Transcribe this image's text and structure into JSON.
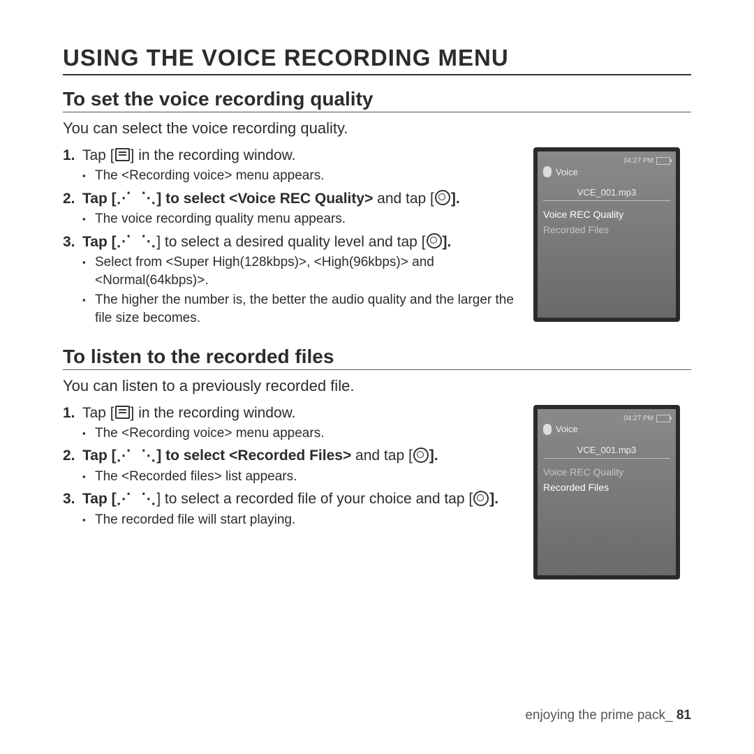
{
  "page": {
    "h1": "USING THE VOICE RECORDING MENU",
    "footer_text": "enjoying the prime pack_",
    "footer_page": "81"
  },
  "sec1": {
    "h2": "To set the voice recording quality",
    "intro": "You can select the voice recording quality.",
    "s1_pre": "Tap [",
    "s1_post": "] in the recording window.",
    "s1_sub1": "The <Recording voice> menu appears.",
    "s2_pre": "Tap [",
    "s2_mid1": "] to select ",
    "s2_bold": "<Voice REC Quality>",
    "s2_mid2": " and tap [",
    "s2_post": "].",
    "s2_sub1": "The voice recording quality menu appears.",
    "s3_pre": "Tap [",
    "s3_mid": "] to select a desired quality level and tap [",
    "s3_post": "].",
    "s3_sub1": "Select from <Super High(128kbps)>, <High(96kbps)> and <Normal(64kbps)>.",
    "s3_sub2": "The higher the number is, the better the audio quality and the larger the file size becomes."
  },
  "sec2": {
    "h2": "To listen to the recorded files",
    "intro": "You can listen to a previously recorded file.",
    "s1_pre": "Tap [",
    "s1_post": "] in the recording window.",
    "s1_sub1": "The <Recording voice> menu appears.",
    "s2_pre": "Tap [",
    "s2_mid1": "] to select ",
    "s2_bold": "<Recorded Files>",
    "s2_mid2": " and tap [",
    "s2_post": "].",
    "s2_sub1": "The <Recorded files> list appears.",
    "s3_pre": "Tap [",
    "s3_mid": "] to select a recorded file of your choice and tap [",
    "s3_post": "].",
    "s3_sub1": "The recorded file will start playing."
  },
  "device": {
    "time": "04:27 PM",
    "title": "Voice",
    "file": "VCE_001.mp3",
    "opt1": "Voice REC Quality",
    "opt2": "Recorded Files"
  },
  "nums": {
    "n1": "1.",
    "n2": "2.",
    "n3": "3."
  },
  "icons": {
    "updown": "⋰ ⋱"
  }
}
